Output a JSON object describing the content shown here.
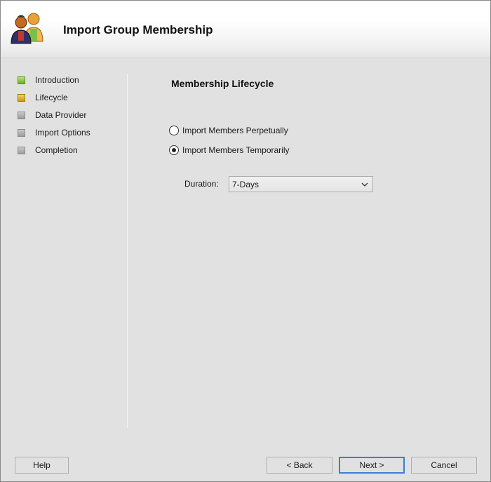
{
  "window": {
    "title": "Import Group Membership"
  },
  "icons": {
    "app": "users-group-icon",
    "dropdown": "chevron-down-icon"
  },
  "steps": [
    {
      "label": "Introduction",
      "status": "done"
    },
    {
      "label": "Lifecycle",
      "status": "current"
    },
    {
      "label": "Data Provider",
      "status": "pending"
    },
    {
      "label": "Import Options",
      "status": "pending"
    },
    {
      "label": "Completion",
      "status": "pending"
    }
  ],
  "main": {
    "section_title": "Membership Lifecycle",
    "options": [
      {
        "label": "Import Members Perpetually",
        "checked": false
      },
      {
        "label": "Import Members Temporarily",
        "checked": true
      }
    ],
    "duration": {
      "label": "Duration:",
      "value": "7-Days"
    }
  },
  "buttons": {
    "help": "Help",
    "back": "< Back",
    "next": "Next >",
    "cancel": "Cancel"
  },
  "colors": {
    "step_done": "#6fae2a",
    "step_current": "#c99c12",
    "step_pending": "#9c9c9c",
    "default_button_border": "#3a7fd3"
  }
}
